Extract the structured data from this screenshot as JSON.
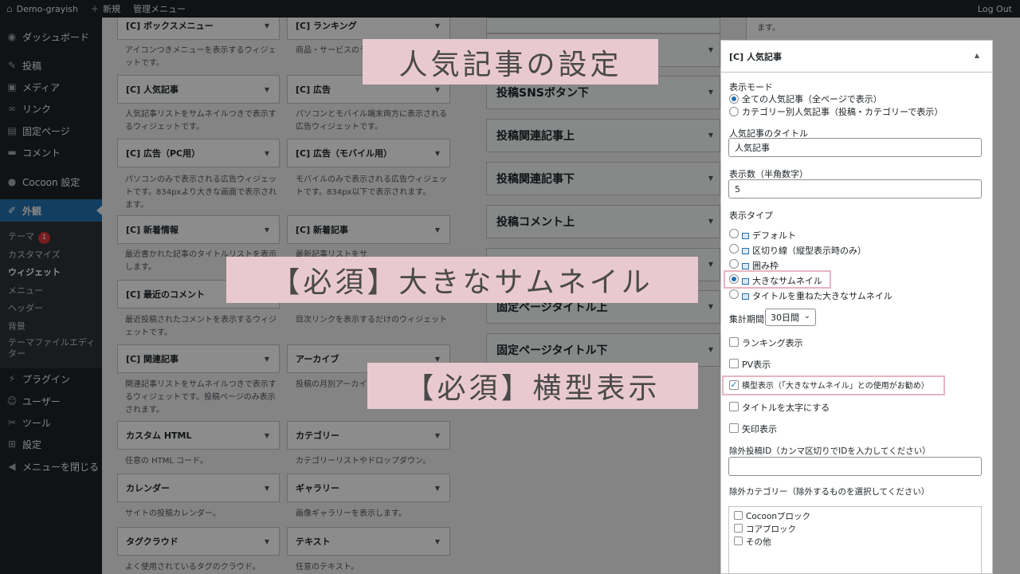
{
  "admin_bar": {
    "site_name": "Demo-grayish",
    "new_label": "新規",
    "admin_menu_label": "管理メニュー",
    "logout_label": "Log Out"
  },
  "sidebar": {
    "items": [
      {
        "label": "ダッシュボード",
        "icon": "dashboard-icon"
      },
      {
        "label": "投稿",
        "icon": "pin-icon"
      },
      {
        "label": "メディア",
        "icon": "media-icon"
      },
      {
        "label": "リンク",
        "icon": "link-icon"
      },
      {
        "label": "固定ページ",
        "icon": "page-icon"
      },
      {
        "label": "コメント",
        "icon": "comment-icon"
      },
      {
        "label": "Cocoon 設定",
        "icon": "cocoon-icon"
      },
      {
        "label": "外観",
        "icon": "brush-icon"
      },
      {
        "label": "プラグイン",
        "icon": "plugin-icon"
      },
      {
        "label": "ユーザー",
        "icon": "user-icon"
      },
      {
        "label": "ツール",
        "icon": "tool-icon"
      },
      {
        "label": "設定",
        "icon": "settings-icon"
      },
      {
        "label": "メニューを閉じる",
        "icon": "collapse-icon"
      }
    ],
    "submenu": [
      {
        "label": "テーマ",
        "badge": "1"
      },
      {
        "label": "カスタマイズ"
      },
      {
        "label": "ウィジェット"
      },
      {
        "label": "メニュー"
      },
      {
        "label": "ヘッダー"
      },
      {
        "label": "背景"
      },
      {
        "label": "テーマファイルエディター"
      }
    ]
  },
  "widgets": [
    {
      "title": "[C] ボックスメニュー",
      "desc": "アイコンつきメニューを表示するウィジェットです。"
    },
    {
      "title": "[C] ランキング",
      "desc": "商品・サービスのラ ウィジェットです。"
    },
    {
      "title": "[C] 人気記事",
      "desc": "人気記事リストをサムネイルつきで表示するウィジェットです。"
    },
    {
      "title": "[C] 広告",
      "desc": "パソコンとモバイル端末両方に表示される広告ウィジェットです。"
    },
    {
      "title": "[C] 広告（PC用）",
      "desc": "パソコンのみで表示される広告ウィジェットです。834pxより大きな画面で表示されます。"
    },
    {
      "title": "[C] 広告（モバイル用）",
      "desc": "モバイルのみで表示される広告ウィジェットです。834px以下で表示されます。"
    },
    {
      "title": "[C] 新着情報",
      "desc": "最近書かれた記事のタイトルリストを表示します。"
    },
    {
      "title": "[C] 新着記事",
      "desc": "最新記事リストをサ"
    },
    {
      "title": "[C] 最近のコメント",
      "desc": "最近投稿されたコメントを表示するウィジェットです。"
    },
    {
      "title": "",
      "desc": "目次リンクを表示するだけのウィジェット"
    },
    {
      "title": "[C] 関連記事",
      "desc": "関連記事リストをサムネイルつきで表示するウィジェットです。投稿ページのみ表示されます。"
    },
    {
      "title": "アーカイブ",
      "desc": "投稿の月別アーカイ"
    },
    {
      "title": "カスタム HTML",
      "desc": "任意の HTML コード。"
    },
    {
      "title": "カテゴリー",
      "desc": "カテゴリーリストやドロップダウン。"
    },
    {
      "title": "カレンダー",
      "desc": "サイトの投稿カレンダー。"
    },
    {
      "title": "ギャラリー",
      "desc": "画像ギャラリーを表示します。"
    },
    {
      "title": "タグクラウド",
      "desc": "よく使用されているタグのクラウド。"
    },
    {
      "title": "テキスト",
      "desc": "任意のテキスト。"
    }
  ],
  "sidebars_column": [
    {
      "title": ""
    },
    {
      "title": "投稿SNSボタン下"
    },
    {
      "title": "投稿関連記事上"
    },
    {
      "title": "投稿関連記事下"
    },
    {
      "title": "投稿コメント上"
    },
    {
      "title": "固定ページタイトル上"
    },
    {
      "title": "固定ページタイトル下"
    }
  ],
  "right_edge_text": "ます。",
  "form": {
    "title": "[C] 人気記事",
    "display_mode_label": "表示モード",
    "display_mode_options": [
      "全ての人気記事（全ページで表示）",
      "カテゴリー別人気記事（投稿・カテゴリーで表示）"
    ],
    "display_mode_selected": 0,
    "widget_title_label": "人気記事のタイトル",
    "widget_title_value": "人気記事",
    "count_label": "表示数（半角数字）",
    "count_value": "5",
    "type_label": "表示タイプ",
    "type_options": [
      "デフォルト",
      "区切り線（縦型表示時のみ）",
      "囲み枠",
      "大きなサムネイル",
      "タイトルを重ねた大きなサムネイル"
    ],
    "type_selected": 3,
    "period_label": "集計期間",
    "period_value": "30日間",
    "checkboxes": [
      {
        "label": "ランキング表示",
        "checked": false
      },
      {
        "label": "PV表示",
        "checked": false
      },
      {
        "label": "横型表示（「大きなサムネイル」との使用がお勧め）",
        "checked": true
      },
      {
        "label": "タイトルを太字にする",
        "checked": false
      },
      {
        "label": "矢印表示",
        "checked": false
      }
    ],
    "exclude_ids_label": "除外投稿ID（カンマ区切りでIDを入力してください）",
    "exclude_ids_value": "",
    "exclude_cats_label": "除外カテゴリー（除外するものを選択してください）",
    "categories": [
      "Cocoonブロック",
      "コアブロック",
      "その他"
    ]
  },
  "banners": {
    "settings_title": "人気記事の設定",
    "required_thumbnail": "【必須】大きなサムネイル",
    "required_horizontal": "【必須】横型表示"
  },
  "colors": {
    "admin_dark": "#1d2327",
    "accent": "#2271b1",
    "banner_bg": "#e9c9d0",
    "highlight_border": "#e8b4c0"
  }
}
